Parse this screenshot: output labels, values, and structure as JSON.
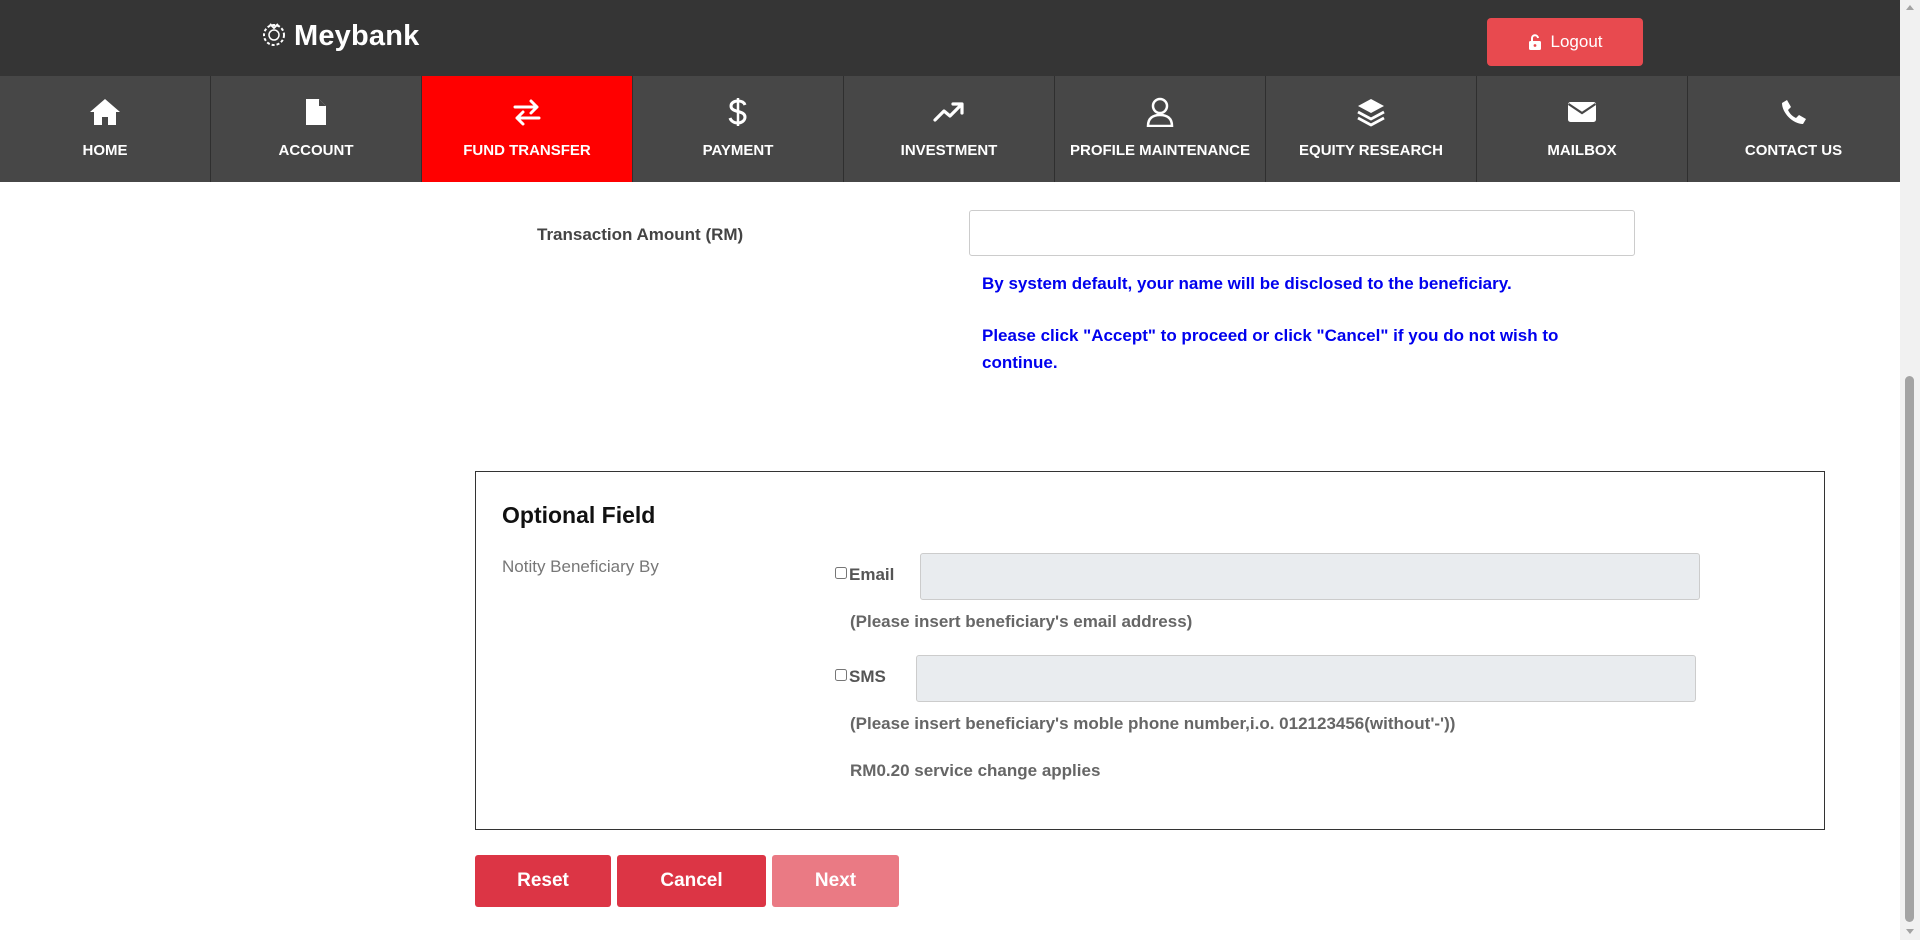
{
  "header": {
    "brand": "Meybank",
    "logout_label": "Logout"
  },
  "nav": {
    "items": [
      {
        "label": "HOME",
        "icon": "home-icon"
      },
      {
        "label": "ACCOUNT",
        "icon": "document-icon"
      },
      {
        "label": "FUND TRANSFER",
        "icon": "transfer-arrows-icon",
        "active": true
      },
      {
        "label": "PAYMENT",
        "icon": "dollar-icon"
      },
      {
        "label": "INVESTMENT",
        "icon": "trending-up-icon"
      },
      {
        "label": "PROFILE MAINTENANCE",
        "icon": "user-icon"
      },
      {
        "label": "EQUITY RESEARCH",
        "icon": "layers-icon"
      },
      {
        "label": "MAILBOX",
        "icon": "envelope-icon"
      },
      {
        "label": "CONTACT US",
        "icon": "phone-icon"
      }
    ]
  },
  "form": {
    "amount_label": "Transaction Amount (RM)",
    "amount_value": "",
    "notice_line1": "By system default, your name will be disclosed to the beneficiary.",
    "notice_line2": "Please click \"Accept\" to proceed or click \"Cancel\" if you do not wish to continue."
  },
  "optional": {
    "title": "Optional Field",
    "notify_label": "Notity Beneficiary By",
    "email_label": "Email",
    "email_checked": false,
    "email_hint": "(Please insert beneficiary's email address)",
    "sms_label": "SMS",
    "sms_checked": false,
    "sms_hint": "(Please insert beneficiary's moble phone number,i.o. 012123456(without'-'))",
    "sms_fee": "RM0.20 service change applies"
  },
  "actions": {
    "reset": "Reset",
    "cancel": "Cancel",
    "next": "Next"
  },
  "colors": {
    "topbar": "#353535",
    "navbar": "#474747",
    "active_tab": "#ff0000",
    "logout": "#e84a4f",
    "button_red": "#dc3545",
    "button_disabled": "#ea7a84",
    "notice_text": "#0000ee"
  }
}
